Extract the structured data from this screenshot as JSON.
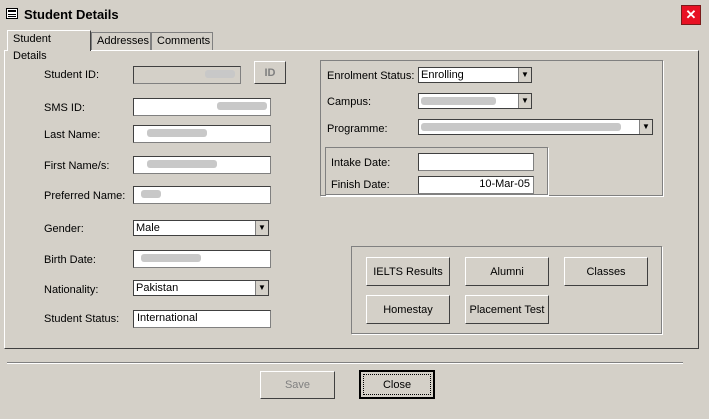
{
  "window": {
    "title": "Student Details",
    "close_glyph": "✕"
  },
  "tabs": [
    {
      "label": "Student Details"
    },
    {
      "label": "Addresses"
    },
    {
      "label": "Comments"
    }
  ],
  "left_form": {
    "student_id": {
      "label": "Student ID:",
      "value": ""
    },
    "id_button": "ID",
    "sms_id": {
      "label": "SMS ID:",
      "value": ""
    },
    "last_name": {
      "label": "Last Name:",
      "value": ""
    },
    "first_name": {
      "label": "First Name/s:",
      "value": ""
    },
    "preferred_name": {
      "label": "Preferred Name:",
      "value": ""
    },
    "gender": {
      "label": "Gender:",
      "value": "Male"
    },
    "birth_date": {
      "label": "Birth Date:",
      "value": ""
    },
    "nationality": {
      "label": "Nationality:",
      "value": "Pakistan"
    },
    "student_status": {
      "label": "Student Status:",
      "value": "International"
    }
  },
  "right_form": {
    "enrolment_status": {
      "label": "Enrolment Status:",
      "value": "Enrolling"
    },
    "campus": {
      "label": "Campus:",
      "value": ""
    },
    "programme": {
      "label": "Programme:",
      "value": ""
    },
    "intake_date": {
      "label": "Intake Date:",
      "value": ""
    },
    "finish_date": {
      "label": "Finish Date:",
      "value": "10-Mar-05"
    }
  },
  "action_buttons": {
    "ielts": "IELTS Results",
    "alumni": "Alumni",
    "classes": "Classes",
    "homestay": "Homestay",
    "placement": "Placement Test"
  },
  "footer": {
    "save": "Save",
    "close": "Close"
  },
  "colors": {
    "window_bg": "#d4d0c8",
    "close_red": "#e81123"
  }
}
